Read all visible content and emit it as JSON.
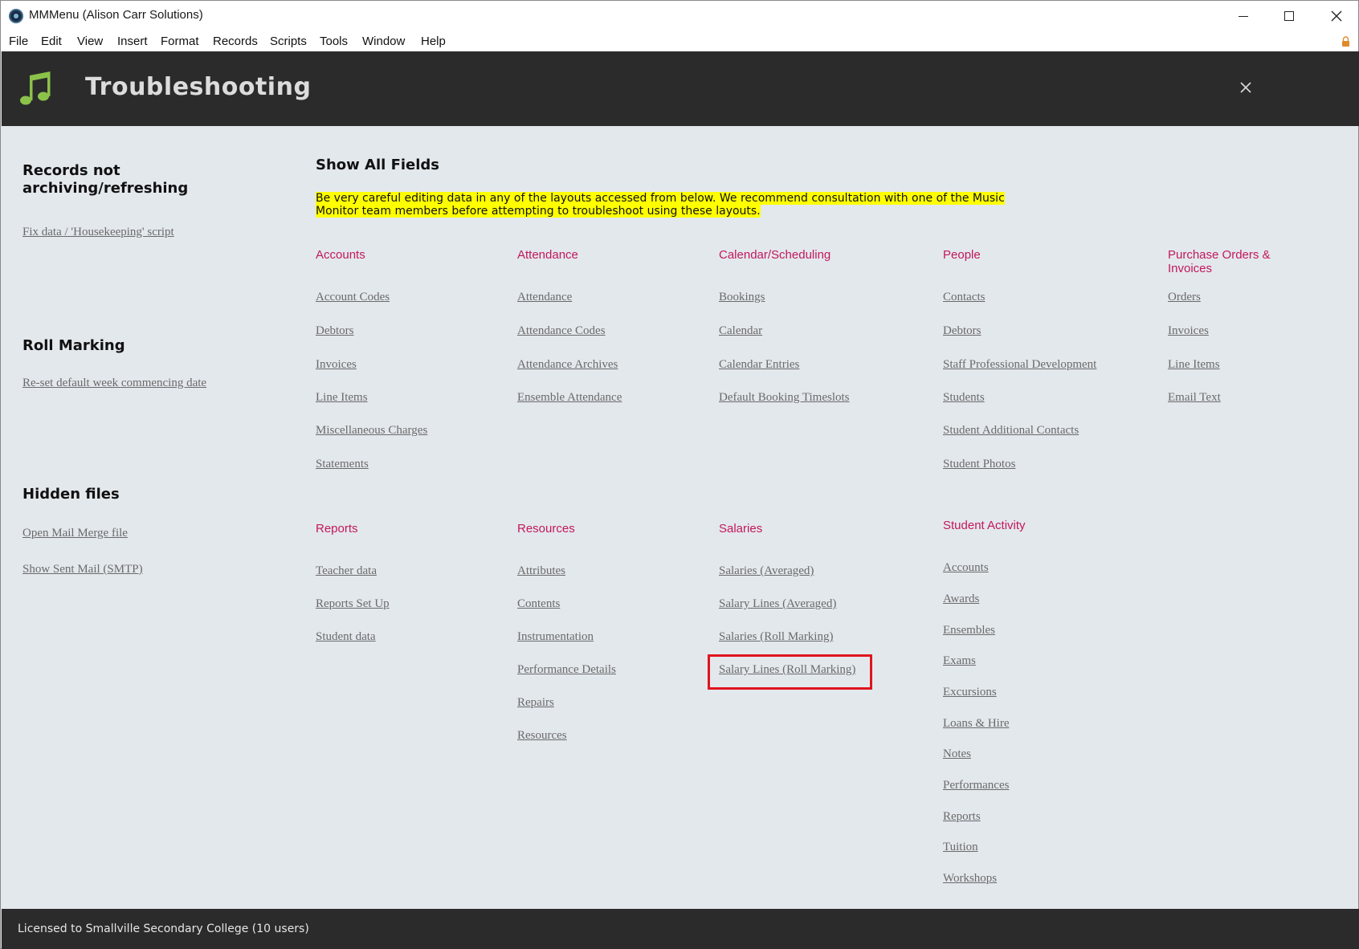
{
  "window": {
    "title": "MMMenu (Alison Carr Solutions)"
  },
  "menubar": [
    "File",
    "Edit",
    "View",
    "Insert",
    "Format",
    "Records",
    "Scripts",
    "Tools",
    "Window",
    "Help"
  ],
  "header": {
    "title": "Troubleshooting"
  },
  "left_panel": {
    "sections": [
      {
        "title": "Records not archiving/refreshing",
        "links": [
          "Fix data / 'Housekeeping' script"
        ]
      },
      {
        "title": "Roll Marking",
        "links": [
          "Re-set default week commencing date"
        ]
      },
      {
        "title": "Hidden files",
        "links": [
          "Open Mail Merge file",
          "Show Sent Mail (SMTP)"
        ]
      }
    ]
  },
  "main": {
    "title": "Show All Fields",
    "warning": "Be very careful editing data in any of the layouts accessed from below. We recommend consultation with one of the Music Monitor team members before attempting to troubleshoot using these layouts.",
    "groups": [
      {
        "heading": "Accounts",
        "links": [
          "Account Codes",
          "Debtors",
          "Invoices",
          "Line Items",
          "Miscellaneous Charges",
          "Statements"
        ]
      },
      {
        "heading": "Attendance",
        "links": [
          "Attendance",
          "Attendance Codes",
          "Attendance Archives",
          "Ensemble Attendance"
        ]
      },
      {
        "heading": "Calendar/Scheduling",
        "links": [
          "Bookings",
          "Calendar",
          "Calendar Entries",
          "Default Booking Timeslots"
        ]
      },
      {
        "heading": "People",
        "links": [
          "Contacts",
          "Debtors",
          "Staff Professional Development",
          "Students",
          "Student Additional Contacts",
          "Student Photos"
        ]
      },
      {
        "heading": "Purchase Orders & Invoices",
        "links": [
          "Orders",
          "Invoices",
          "Line Items",
          "Email Text"
        ]
      },
      {
        "heading": "Reports",
        "links": [
          "Teacher data",
          "Reports Set Up",
          "Student data"
        ]
      },
      {
        "heading": "Resources",
        "links": [
          "Attributes",
          "Contents",
          "Instrumentation",
          "Performance Details",
          "Repairs",
          "Resources"
        ]
      },
      {
        "heading": "Salaries",
        "links": [
          "Salaries (Averaged)",
          "Salary Lines (Averaged)",
          "Salaries (Roll Marking)",
          "Salary Lines (Roll Marking)"
        ]
      },
      {
        "heading": "Student Activity",
        "links": [
          "Accounts",
          "Awards",
          "Ensembles",
          "Exams",
          "Excursions",
          "Loans & Hire",
          "Notes",
          "Performances",
          "Reports",
          "Tuition",
          "Workshops"
        ]
      }
    ]
  },
  "footer": {
    "text": "Licensed to Smallville Secondary College (10 users)"
  },
  "colors": {
    "header_bg": "#2b2b2b",
    "content_bg": "#e3e8ed",
    "heading_pink": "#c2185b",
    "note_icon_green": "#8bc34a",
    "warning_highlight": "#ffff00",
    "selection_box": "#e0141e"
  },
  "icons": [
    "app-icon",
    "music-note-icon",
    "close-icon",
    "lock-icon",
    "minimize-icon",
    "maximize-icon"
  ]
}
